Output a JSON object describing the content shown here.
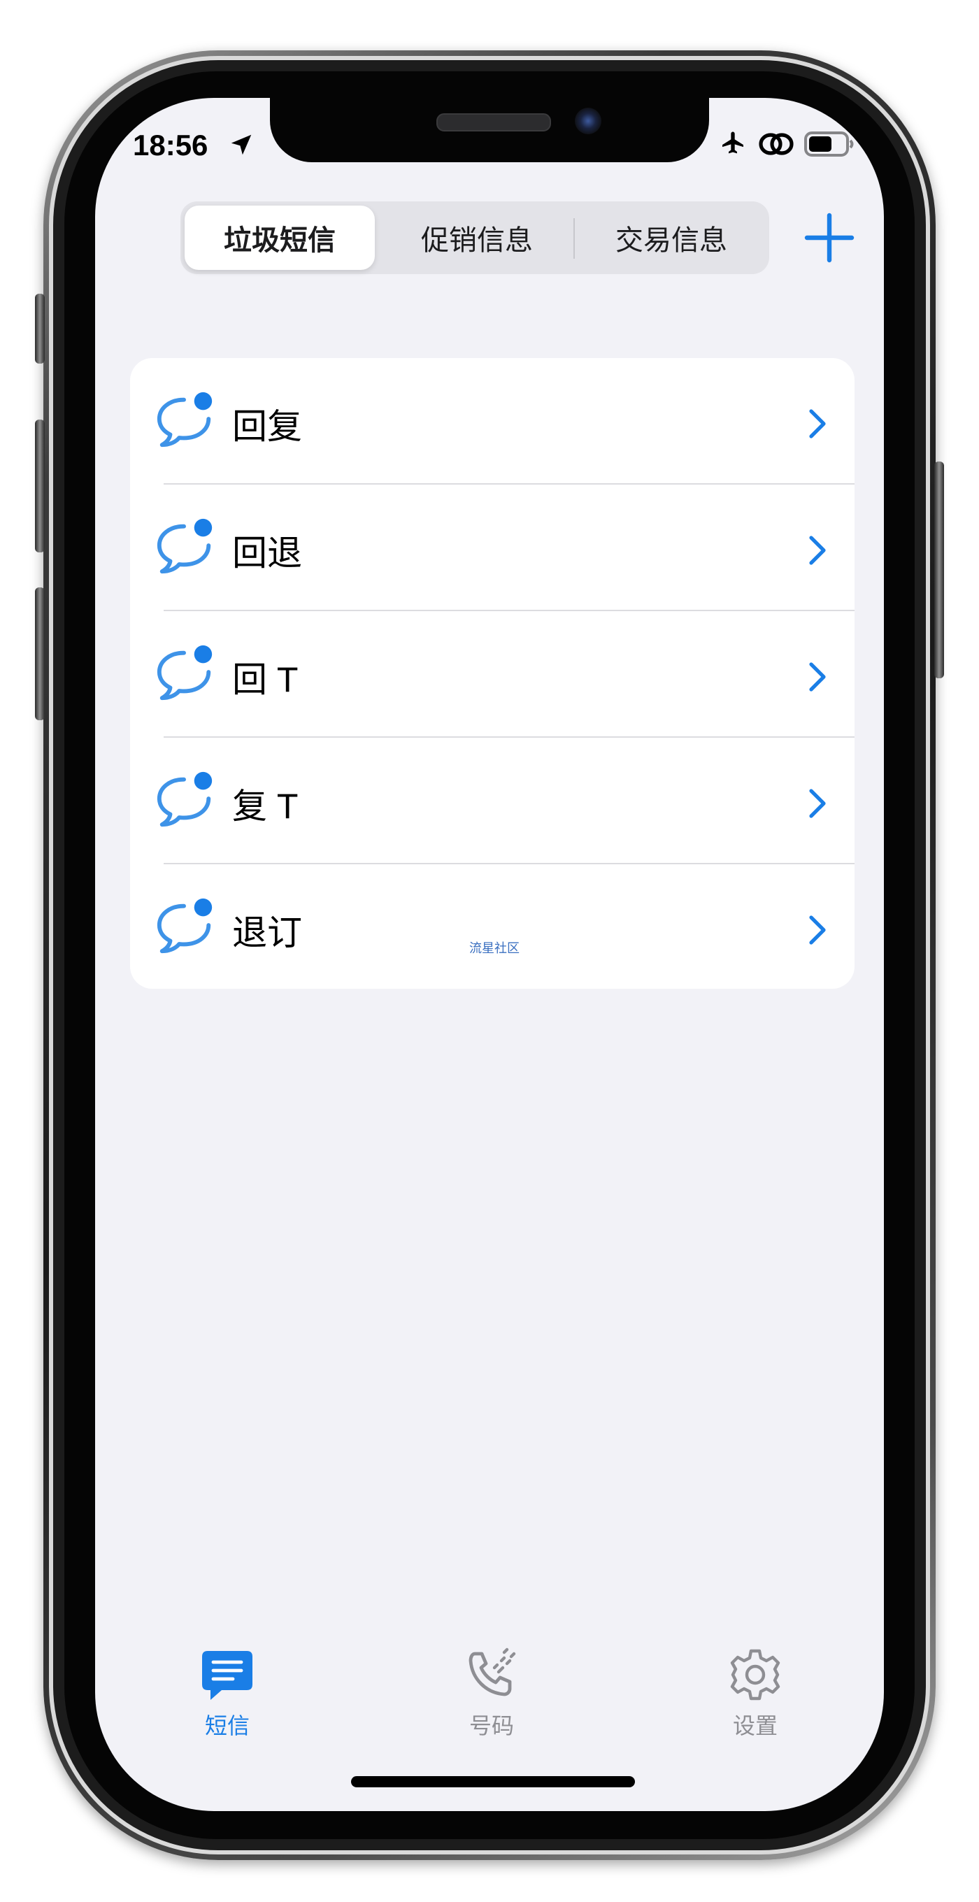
{
  "status_bar": {
    "time": "18:56",
    "icons": [
      "location-arrow-icon",
      "airplane-icon",
      "link-icon",
      "battery-icon"
    ]
  },
  "segmented_control": {
    "tabs": [
      {
        "label": "垃圾短信",
        "selected": true
      },
      {
        "label": "促销信息",
        "selected": false
      },
      {
        "label": "交易信息",
        "selected": false
      }
    ],
    "add_icon": "plus-icon"
  },
  "keyword_list": {
    "items": [
      {
        "label": "回复",
        "icon": "chat-bubble-dot-icon"
      },
      {
        "label": "回退",
        "icon": "chat-bubble-dot-icon"
      },
      {
        "label": "回 T",
        "icon": "chat-bubble-dot-icon"
      },
      {
        "label": "复 T",
        "icon": "chat-bubble-dot-icon"
      },
      {
        "label": "退订",
        "icon": "chat-bubble-dot-icon"
      }
    ],
    "watermark": "流星社区"
  },
  "tab_bar": {
    "tabs": [
      {
        "label": "短信",
        "icon": "message-icon",
        "active": true
      },
      {
        "label": "号码",
        "icon": "phone-icon",
        "active": false
      },
      {
        "label": "设置",
        "icon": "gear-icon",
        "active": false
      }
    ]
  },
  "colors": {
    "accent": "#1a7ee6",
    "background": "#f2f2f7",
    "inactive": "#8e8e93"
  }
}
